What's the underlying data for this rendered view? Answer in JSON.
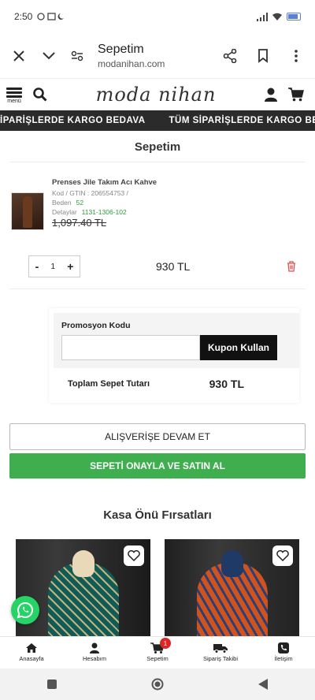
{
  "status": {
    "time": "2:50",
    "signal": "signal",
    "battery": ""
  },
  "browser": {
    "title": "Sepetim",
    "domain": "modanihan.com"
  },
  "header": {
    "menu_label": "menü",
    "logo": "moda nihan"
  },
  "marquee": {
    "items": [
      "İPARİŞLERDE KARGO BEDAVA",
      "TÜM SİPARİŞLERDE KARGO BEDAVA"
    ]
  },
  "cart": {
    "title": "Sepetim",
    "item": {
      "name": "Prenses Jile Takım Acı Kahve",
      "code_label": "Kod / GTIN : 206554753 /",
      "size_label": "Beden",
      "size_value": "52",
      "detail_label": "Detaylar",
      "detail_value": "1131-1306-102",
      "old_price": "1,097.40 TL",
      "quantity": "1",
      "price": "930 TL"
    },
    "promo": {
      "label": "Promosyon Kodu",
      "placeholder": "",
      "button": "Kupon Kullan"
    },
    "total_label": "Toplam Sepet Tutarı",
    "total_value": "930 TL",
    "continue_button": "ALIŞVERİŞE DEVAM ET",
    "checkout_button": "SEPETİ ONAYLA VE SATIN AL"
  },
  "deals": {
    "title": "Kasa Önü Fırsatları"
  },
  "bottom_nav": {
    "items": [
      {
        "label": "Anasayfa",
        "icon": "home-icon"
      },
      {
        "label": "Hesabım",
        "icon": "user-icon"
      },
      {
        "label": "Sepetim",
        "icon": "cart-icon",
        "badge": "1"
      },
      {
        "label": "Sipariş Takibi",
        "icon": "truck-icon"
      },
      {
        "label": "İletişim",
        "icon": "phone-icon"
      }
    ]
  },
  "colors": {
    "green": "#3fae4f",
    "dark": "#2b2b2b",
    "badge": "#e02424",
    "whatsapp": "#25d366"
  }
}
